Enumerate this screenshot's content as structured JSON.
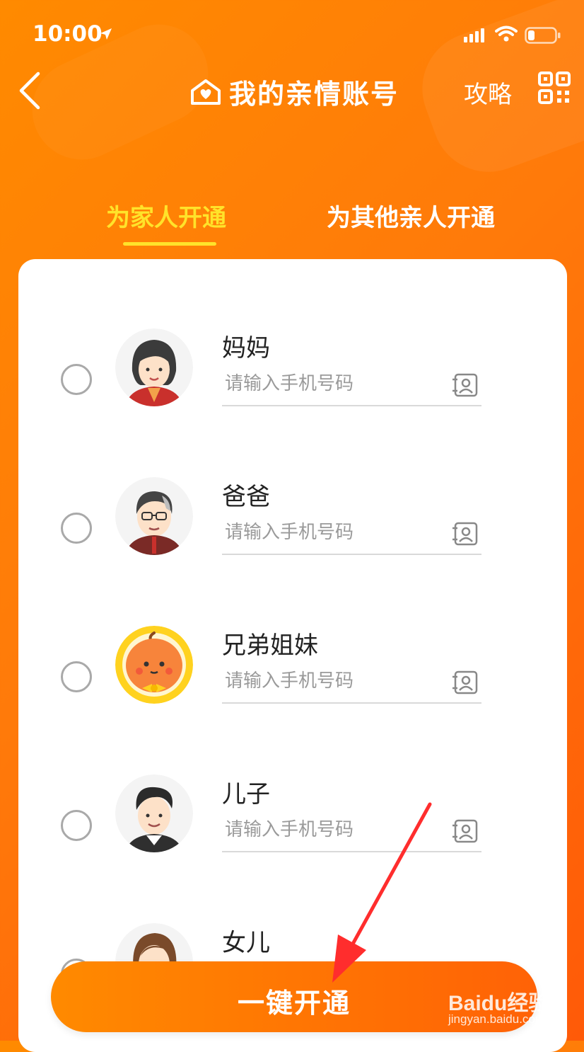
{
  "status_bar": {
    "time": "10:00"
  },
  "nav": {
    "title": "我的亲情账号",
    "strategy_label": "攻略"
  },
  "tabs": [
    {
      "label": "为家人开通",
      "active": true
    },
    {
      "label": "为其他亲人开通",
      "active": false
    }
  ],
  "members": [
    {
      "name": "妈妈",
      "placeholder": "请输入手机号码",
      "avatar": "mother-avatar"
    },
    {
      "name": "爸爸",
      "placeholder": "请输入手机号码",
      "avatar": "father-avatar"
    },
    {
      "name": "兄弟姐妹",
      "placeholder": "请输入手机号码",
      "avatar": "sibling-avatar"
    },
    {
      "name": "儿子",
      "placeholder": "请输入手机号码",
      "avatar": "son-avatar"
    },
    {
      "name": "女儿",
      "avatar": "daughter-avatar"
    }
  ],
  "cta": {
    "label": "一键开通"
  },
  "watermark": {
    "main": "Baidu经验",
    "sub": "jingyan.baidu.com"
  },
  "colors": {
    "accent": "#ff7a0a",
    "tab_active": "#ffe32a",
    "card": "#ffffff"
  }
}
